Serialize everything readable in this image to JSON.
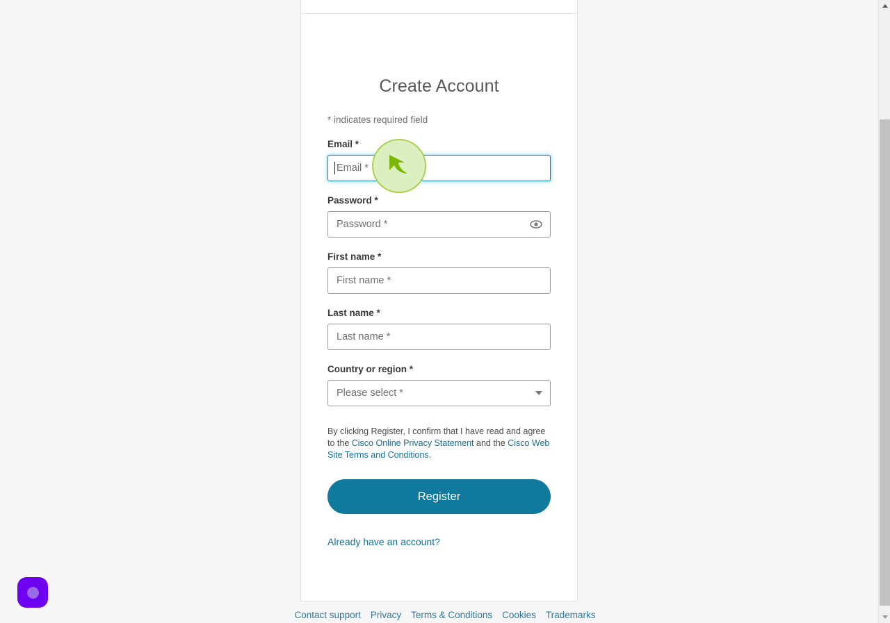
{
  "page": {
    "title": "Create Account",
    "required_note": "* indicates required field"
  },
  "form": {
    "email": {
      "label": "Email *",
      "placeholder": "Email *",
      "value": ""
    },
    "password": {
      "label": "Password *",
      "placeholder": "Password *",
      "value": "",
      "toggle_icon": "eye-icon"
    },
    "first_name": {
      "label": "First name *",
      "placeholder": "First name *",
      "value": ""
    },
    "last_name": {
      "label": "Last name *",
      "placeholder": "Last name *",
      "value": ""
    },
    "country": {
      "label": "Country or region *",
      "selected": "Please select *",
      "arrow_icon": "chevron-down-icon"
    }
  },
  "legal": {
    "text_start": "By clicking Register, I confirm that I have read and agree to the ",
    "link_privacy": "Cisco Online Privacy Statement",
    "text_middle": " and the ",
    "link_terms": "Cisco Web Site Terms and Conditions",
    "text_end": "."
  },
  "actions": {
    "register_label": "Register",
    "already_have_account": "Already have an account?"
  },
  "footer": {
    "links": [
      "Contact support",
      "Privacy",
      "Terms & Conditions",
      "Cookies",
      "Trademarks"
    ]
  },
  "overlay": {
    "cursor_icon": "arrow-cursor-icon",
    "widget_icon": "purple-circle-badge-icon"
  },
  "colors": {
    "brand_button": "#0f7a9e",
    "link": "#147099",
    "focus_border": "#1c7fc4",
    "cursor_green": "#7ab800",
    "widget_purple": "#6d00f0"
  }
}
